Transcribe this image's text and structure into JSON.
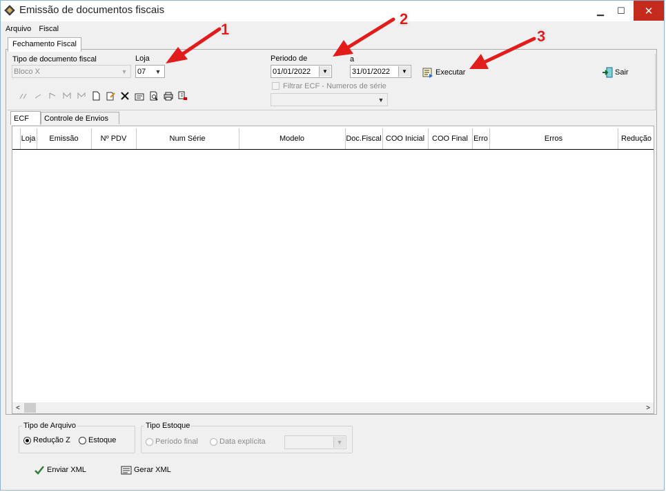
{
  "window": {
    "title": "Emissão de documentos fiscais",
    "minimize": "▁",
    "maximize": "☐",
    "close": "✕"
  },
  "menu": [
    {
      "label": "Arquivo"
    },
    {
      "label": "Fiscal"
    }
  ],
  "top_tab": "Fechamento Fiscal",
  "form": {
    "tipo_label": "Tipo de documento fiscal",
    "tipo_value": "Bloco X",
    "loja_label": "Loja",
    "loja_value": "07",
    "periodo_label": "Periodo  de",
    "periodo_from": "01/01/2022",
    "a_label": "a",
    "periodo_to": "31/01/2022",
    "executar_label": "Executar",
    "sair_label": "Sair",
    "filtrar_label": "Filtrar ECF - Numeros de  série",
    "filtrar_combo_value": ""
  },
  "inner_tabs": [
    {
      "label": "ECF"
    },
    {
      "label": "Controle de Envios"
    }
  ],
  "grid_columns": [
    "Loja",
    "Emissão",
    "Nº PDV",
    "Num Série",
    "Modelo",
    "Doc.Fiscal",
    "COO Inicial",
    "COO Final",
    "Erro",
    "Erros",
    "Redução Z"
  ],
  "tipo_arquivo": {
    "legend": "Tipo de Arquivo",
    "options": [
      {
        "label": "Redução Z",
        "selected": true
      },
      {
        "label": "Estoque",
        "selected": false
      }
    ]
  },
  "tipo_estoque": {
    "legend": "Tipo Estoque",
    "options": [
      {
        "label": "Período final",
        "selected": false
      },
      {
        "label": "Data explícita",
        "selected": false
      }
    ],
    "combo_value": ""
  },
  "bottom_buttons": {
    "enviar": "Enviar XML",
    "gerar": "Gerar XML"
  },
  "annotations": [
    "1",
    "2",
    "3"
  ],
  "colors": {
    "annotation_red": "#e21b1b",
    "close_button": "#c42b1c"
  },
  "icons": {
    "toolbar": [
      "first-icon",
      "prev-icon",
      "next-icon",
      "last-icon",
      "refresh-icon",
      "new-icon",
      "edit-icon",
      "delete-icon",
      "properties-icon",
      "preview-icon",
      "print-icon",
      "export-icon"
    ]
  }
}
